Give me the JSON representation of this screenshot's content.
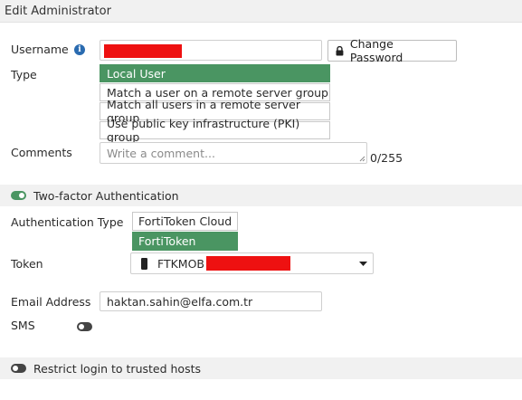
{
  "header": {
    "title": "Edit Administrator"
  },
  "username": {
    "label": "Username",
    "change_password_label": "Change Password"
  },
  "type": {
    "label": "Type",
    "options": [
      "Local User",
      "Match a user on a remote server group",
      "Match all users in a remote server group",
      "Use public key infrastructure (PKI) group"
    ],
    "selected": "Local User"
  },
  "comments": {
    "label": "Comments",
    "placeholder": "Write a comment...",
    "counter": "0/255"
  },
  "two_factor": {
    "label": "Two-factor Authentication",
    "enabled": true,
    "auth_type_label": "Authentication Type",
    "auth_type_options": [
      "FortiToken Cloud",
      "FortiToken"
    ],
    "auth_type_selected": "FortiToken",
    "token_label": "Token",
    "token_value_prefix": "FTKMOB",
    "email_label": "Email Address",
    "email_value": "haktan.sahin@elfa.com.tr",
    "sms_label": "SMS",
    "sms_enabled": false
  },
  "trusted_hosts": {
    "label": "Restrict login to trusted hosts",
    "enabled": false
  },
  "colors": {
    "accent": "#4a9562",
    "redaction": "#ee1111",
    "info": "#2a6bb0"
  }
}
